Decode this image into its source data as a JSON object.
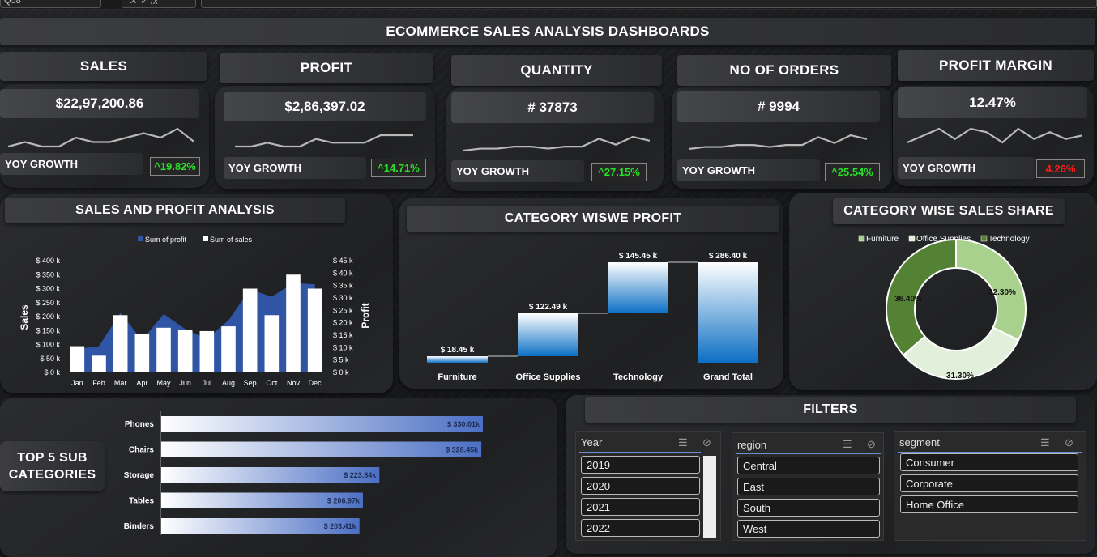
{
  "app": {
    "namebox": "Q58",
    "fx_symbol": "fx"
  },
  "title": "ECOMMERCE SALES ANALYSIS DASHBOARDS",
  "kpis": [
    {
      "name": "SALES",
      "value": "$22,97,200.86",
      "yoy_label": "YOY GROWTH",
      "growth": "^19.82%",
      "growth_color": "#28e028",
      "spark": [
        17,
        16,
        17,
        17,
        15,
        16,
        16,
        15,
        14,
        15,
        13,
        16
      ]
    },
    {
      "name": "PROFIT",
      "value": "$2,86,397.02",
      "yoy_label": "YOY GROWTH",
      "growth": "^14.71%",
      "growth_color": "#28e028",
      "spark": [
        16,
        16,
        15,
        16,
        16,
        14,
        15,
        15,
        15,
        13,
        13,
        13
      ]
    },
    {
      "name": "QUANTITY",
      "value": "# 37873",
      "yoy_label": "YOY GROWTH",
      "growth": "^27.15%",
      "growth_color": "#28e028",
      "spark": [
        18,
        17,
        17,
        16,
        16,
        17,
        16,
        16,
        12,
        15,
        11,
        13
      ]
    },
    {
      "name": "NO OF ORDERS",
      "value": "# 9994",
      "yoy_label": "YOY GROWTH",
      "growth": "^25.54%",
      "growth_color": "#28e028",
      "spark": [
        18,
        17,
        17,
        16,
        16,
        17,
        16,
        16,
        12,
        15,
        11,
        13
      ]
    },
    {
      "name": "PROFIT MARGIN",
      "value": "12.47%",
      "yoy_label": "YOY GROWTH",
      "growth": "4.26%",
      "growth_color": "#ff1a1a",
      "spark": [
        14,
        12,
        10,
        13,
        10,
        11,
        14,
        10,
        13,
        11,
        13,
        12
      ]
    }
  ],
  "sales_profit": {
    "title": "SALES AND PROFIT  ANALYSIS",
    "legend_profit": "Sum of profit",
    "legend_sales": "Sum of sales",
    "ylabel_left": "Sales",
    "ylabel_right": "Profit",
    "left_ticks": [
      "$ 400 k",
      "$ 350 k",
      "$ 300 k",
      "$ 250 k",
      "$ 200 k",
      "$ 150 k",
      "$ 100 k",
      "$ 50 k",
      "$ 0 k"
    ],
    "right_ticks": [
      "$ 45 k",
      "$ 40 k",
      "$ 35 k",
      "$ 30 k",
      "$ 25 k",
      "$ 20 k",
      "$ 15 k",
      "$ 10 k",
      "$ 5 k",
      "$ 0 k"
    ]
  },
  "chart_data": [
    {
      "type": "bar",
      "title": "SALES AND PROFIT  ANALYSIS",
      "categories": [
        "Jan",
        "Feb",
        "Mar",
        "Apr",
        "May",
        "Jun",
        "Jul",
        "Aug",
        "Sep",
        "Oct",
        "Nov",
        "Dec"
      ],
      "series": [
        {
          "name": "Sum of sales",
          "type": "bar",
          "axis": "left",
          "values": [
            94,
            60,
            205,
            138,
            160,
            152,
            148,
            165,
            300,
            205,
            350,
            300
          ]
        },
        {
          "name": "Sum of profit",
          "type": "area",
          "axis": "right",
          "values": [
            9.5,
            10.5,
            24,
            13,
            23.5,
            17.5,
            13.5,
            21,
            33.5,
            30.5,
            36,
            35.5
          ]
        }
      ],
      "ylabel": "Sales",
      "y2label": "Profit",
      "ylim": [
        0,
        400
      ],
      "y2lim": [
        0,
        45
      ],
      "legend": "top"
    },
    {
      "type": "bar",
      "title": "CATEGORY WISWE PROFIT",
      "subtype": "waterfall",
      "categories": [
        "Furniture",
        "Office Supplies",
        "Technology",
        "Grand Total"
      ],
      "values": [
        18.45,
        122.49,
        145.45,
        286.4
      ],
      "labels": [
        "$ 18.45 k",
        "$ 122.49 k",
        "$ 145.45 k",
        "$ 286.40 k"
      ]
    },
    {
      "type": "pie",
      "title": "CATEGORY WISE SALES SHARE",
      "categories": [
        "Furniture",
        "Office Supplies",
        "Technology"
      ],
      "values": [
        32.3,
        31.3,
        36.4
      ],
      "labels": [
        "32.30%",
        "31.30%",
        "36.40%"
      ],
      "colors": [
        "#a9d18e",
        "#e2efda",
        "#548235"
      ],
      "legend": "top"
    },
    {
      "type": "bar",
      "orientation": "horizontal",
      "title": "TOP 5 SUB CATEGORIES",
      "categories": [
        "Phones",
        "Chairs",
        "Storage",
        "Tables",
        "Binders"
      ],
      "values": [
        330.01,
        328.45,
        223.84,
        206.97,
        203.41
      ],
      "labels": [
        "$ 330.01k",
        "$ 328.45k",
        "$ 223.84k",
        "$ 206.97k",
        "$ 203.41k"
      ]
    }
  ],
  "category_profit_title": "CATEGORY WISWE PROFIT",
  "category_share": {
    "title": "CATEGORY WISE SALES SHARE",
    "legend": [
      "Furniture",
      "Office Supplies",
      "Technology"
    ]
  },
  "top5": {
    "title_line1": "TOP 5 SUB",
    "title_line2": "CATEGORIES"
  },
  "filters": {
    "title": "FILTERS",
    "year": {
      "label": "Year",
      "items": [
        "2019",
        "2020",
        "2021",
        "2022"
      ]
    },
    "region": {
      "label": "region",
      "items": [
        "Central",
        "East",
        "South",
        "West"
      ]
    },
    "segment": {
      "label": "segment",
      "items": [
        "Consumer",
        "Corporate",
        "Home Office"
      ]
    }
  }
}
